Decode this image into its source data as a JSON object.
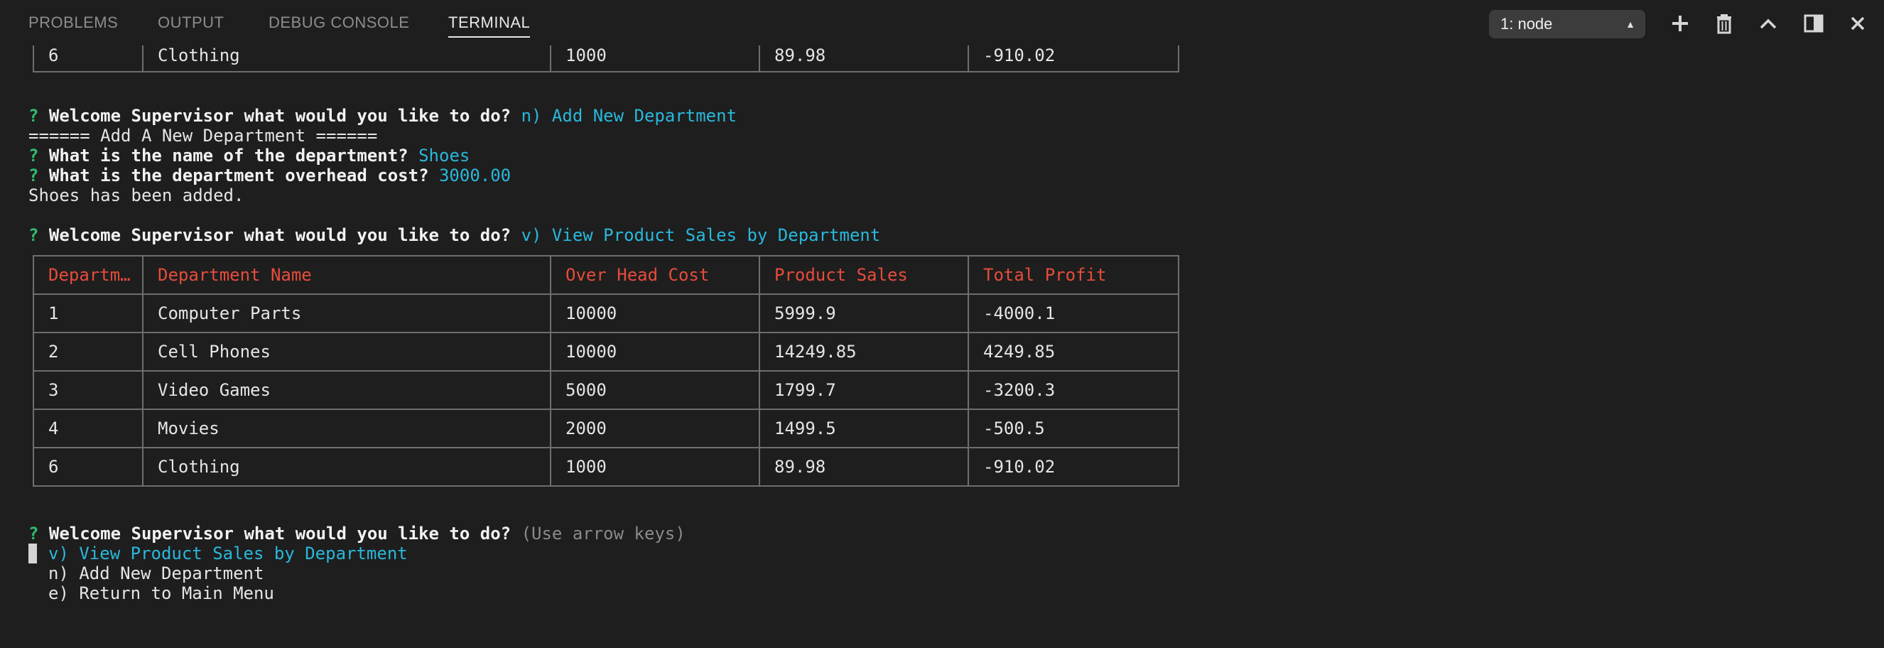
{
  "panel": {
    "tabs": [
      {
        "label": "PROBLEMS",
        "active": false
      },
      {
        "label": "OUTPUT",
        "active": false
      },
      {
        "label": "DEBUG CONSOLE",
        "active": false
      },
      {
        "label": "TERMINAL",
        "active": true
      }
    ],
    "terminal_selector": {
      "value": "1: node",
      "icon": "chevron-updown-icon"
    },
    "actions": [
      {
        "name": "new-terminal",
        "icon": "plus-icon"
      },
      {
        "name": "kill-terminal",
        "icon": "trash-icon"
      },
      {
        "name": "maximize-panel",
        "icon": "chevron-up-icon"
      },
      {
        "name": "toggle-panel-layout",
        "icon": "split-panel-icon"
      },
      {
        "name": "close-panel",
        "icon": "close-icon"
      }
    ]
  },
  "terminal": {
    "top_partial_row": [
      "6",
      "Clothing",
      "1000",
      "89.98",
      "-910.02"
    ],
    "session1": {
      "qmark": "?",
      "prompt": "Welcome Supervisor what would you like to do?",
      "answer": "n) Add New Department"
    },
    "banner": "====== Add A New Department ======",
    "q_name": {
      "qmark": "?",
      "prompt": "What is the name of the department?",
      "answer": "Shoes"
    },
    "q_cost": {
      "qmark": "?",
      "prompt": "What is the department overhead cost?",
      "answer": "3000.00"
    },
    "added_msg": "Shoes has been added.",
    "session2": {
      "qmark": "?",
      "prompt": "Welcome Supervisor what would you like to do?",
      "answer": "v) View Product Sales by Department"
    },
    "table": {
      "headers": [
        "Departm…",
        "Department Name",
        "Over Head Cost",
        "Product Sales",
        "Total Profit"
      ],
      "rows": [
        [
          "1",
          "Computer Parts",
          "10000",
          "5999.9",
          "-4000.1"
        ],
        [
          "2",
          "Cell Phones",
          "10000",
          "14249.85",
          "4249.85"
        ],
        [
          "3",
          "Video Games",
          "5000",
          "1799.7",
          "-3200.3"
        ],
        [
          "4",
          "Movies",
          "2000",
          "1499.5",
          "-500.5"
        ],
        [
          "6",
          "Clothing",
          "1000",
          "89.98",
          "-910.02"
        ]
      ]
    },
    "session3": {
      "qmark": "?",
      "prompt": "Welcome Supervisor what would you like to do?",
      "hint": "(Use arrow keys)"
    },
    "menu": [
      {
        "label": "v) View Product Sales by Department",
        "selected": true
      },
      {
        "label": "n) Add New Department",
        "selected": false
      },
      {
        "label": "e) Return to Main Menu",
        "selected": false
      }
    ]
  },
  "colors": {
    "background": "#1e1e1e",
    "question_mark": "#2fbd6a",
    "answer": "#29b8db",
    "table_header": "#e74c3c",
    "table_border": "#6e6e6e",
    "hint": "#8a8a8a"
  }
}
